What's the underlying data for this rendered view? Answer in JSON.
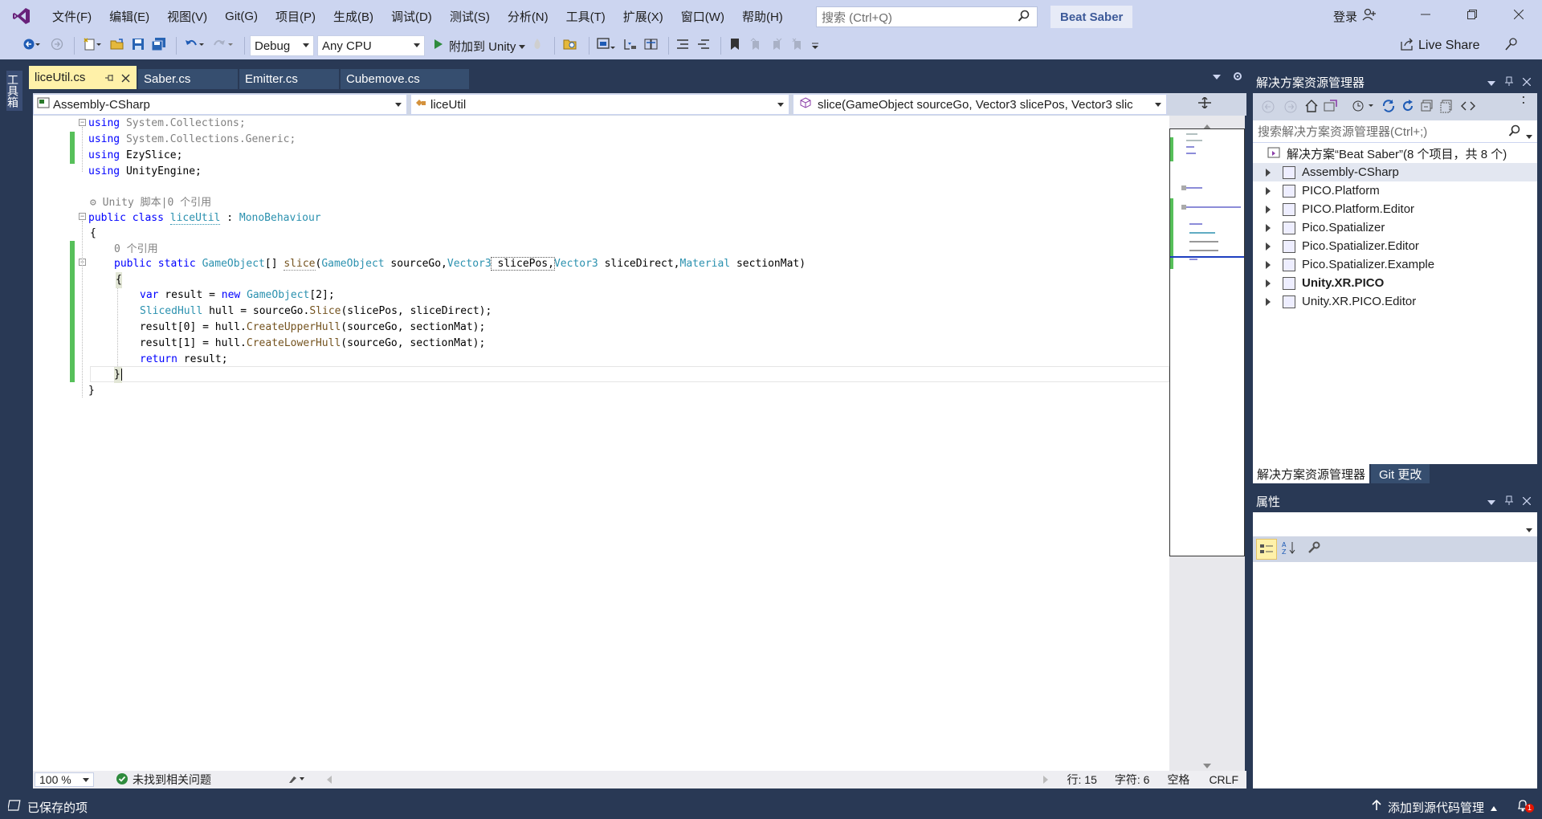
{
  "menu": [
    "文件(F)",
    "编辑(E)",
    "视图(V)",
    "Git(G)",
    "项目(P)",
    "生成(B)",
    "调试(D)",
    "测试(S)",
    "分析(N)",
    "工具(T)",
    "扩展(X)",
    "窗口(W)",
    "帮助(H)"
  ],
  "search": {
    "placeholder": "搜索 (Ctrl+Q)"
  },
  "project_name": "Beat Saber",
  "login": "登录",
  "toolbar": {
    "config": "Debug",
    "platform": "Any CPU",
    "attach": "附加到 Unity",
    "live_share": "Live Share"
  },
  "toolbox_label": "工具箱",
  "tabs": [
    {
      "label": "liceUtil.cs",
      "active": true
    },
    {
      "label": "Saber.cs"
    },
    {
      "label": "Emitter.cs"
    },
    {
      "label": "Cubemove.cs"
    }
  ],
  "nav": {
    "project": "Assembly-CSharp",
    "class": "liceUtil",
    "member": "slice(GameObject sourceGo, Vector3 slicePos, Vector3 slic"
  },
  "code": {
    "l1": [
      "using",
      " System.Collections;"
    ],
    "l2": [
      "using",
      " System.Collections.Generic;"
    ],
    "l3": [
      "using",
      " EzySlice;"
    ],
    "l4": [
      "using",
      " UnityEngine;"
    ],
    "codelens1": "Unity 脚本|0 个引用",
    "l6": [
      "public",
      "class",
      "liceUtil",
      " : ",
      "MonoBehaviour"
    ],
    "l7": "{",
    "codelens2": "0 个引用",
    "l9": [
      "public",
      "static",
      "GameObject",
      "[] ",
      "slice",
      "(",
      "GameObject",
      " sourceGo,",
      "Vector3",
      " slicePos,",
      "Vector3",
      " sliceDirect,",
      "Material",
      " sectionMat)"
    ],
    "l10": "{",
    "l11": [
      "var",
      " result = ",
      "new",
      " ",
      "GameObject",
      "[2];"
    ],
    "l12": [
      "SlicedHull",
      " hull = sourceGo.",
      "Slice",
      "(slicePos, sliceDirect);"
    ],
    "l13": [
      " result[0] = hull.",
      "CreateUpperHull",
      "(sourceGo, sectionMat);"
    ],
    "l14": [
      " result[1] = hull.",
      "CreateLowerHull",
      "(sourceGo, sectionMat);"
    ],
    "l15": [
      "return",
      " result;"
    ],
    "l16": "}",
    "l17": "}"
  },
  "editor_status": {
    "zoom": "100 %",
    "issues": "未找到相关问题",
    "line": "行: 15",
    "char": "字符: 6",
    "space": "空格",
    "eol": "CRLF"
  },
  "solution": {
    "title": "解决方案资源管理器",
    "search_placeholder": "搜索解决方案资源管理器(Ctrl+;)",
    "root": "解决方案“Beat Saber”(8 个项目，共 8 个)",
    "projects": [
      "Assembly-CSharp",
      "PICO.Platform",
      "PICO.Platform.Editor",
      "Pico.Spatializer",
      "Pico.Spatializer.Editor",
      "Pico.Spatializer.Example",
      "Unity.XR.PICO",
      "Unity.XR.PICO.Editor"
    ],
    "bold_project": "Unity.XR.PICO"
  },
  "solution_tabs": [
    "解决方案资源管理器",
    "Git 更改"
  ],
  "properties": {
    "title": "属性"
  },
  "status": {
    "saved": "已保存的项",
    "source_control": "添加到源代码管理",
    "notifications": "1"
  },
  "colors": {
    "frame": "#293955",
    "chrome": "#ccd5f0",
    "active_tab": "#fff1a9",
    "keyword": "#0000ff",
    "type": "#2b91af",
    "changed_bar": "#57c05a"
  }
}
